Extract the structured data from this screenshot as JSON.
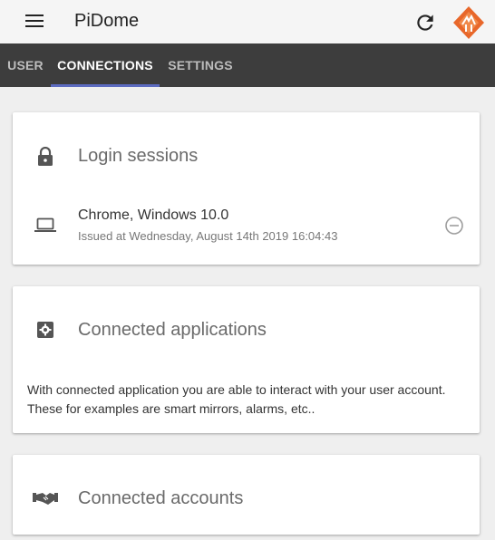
{
  "app": {
    "title": "PiDome"
  },
  "tabs": [
    {
      "label": "USER"
    },
    {
      "label": "CONNECTIONS",
      "active": true
    },
    {
      "label": "SETTINGS"
    }
  ],
  "login_sessions": {
    "title": "Login sessions",
    "icon": "lock-icon",
    "sessions": [
      {
        "device_icon": "laptop-icon",
        "name": "Chrome, Windows 10.0",
        "issued": "Issued at Wednesday, August 14th 2019 16:04:43"
      }
    ]
  },
  "connected_applications": {
    "title": "Connected applications",
    "icon": "puzzle-icon",
    "description_line1": "With connected application you are able to interact with your user account.",
    "description_line2": "These for examples are smart mirrors, alarms, etc.."
  },
  "connected_accounts": {
    "title": "Connected accounts",
    "icon": "handshake-icon"
  },
  "colors": {
    "appbar_bg": "#f5f5f5",
    "tabbar_bg": "#3d3d3d",
    "tab_indicator": "#5c6bc0",
    "logo_orange": "#e8672a",
    "page_bg": "#efefef"
  }
}
